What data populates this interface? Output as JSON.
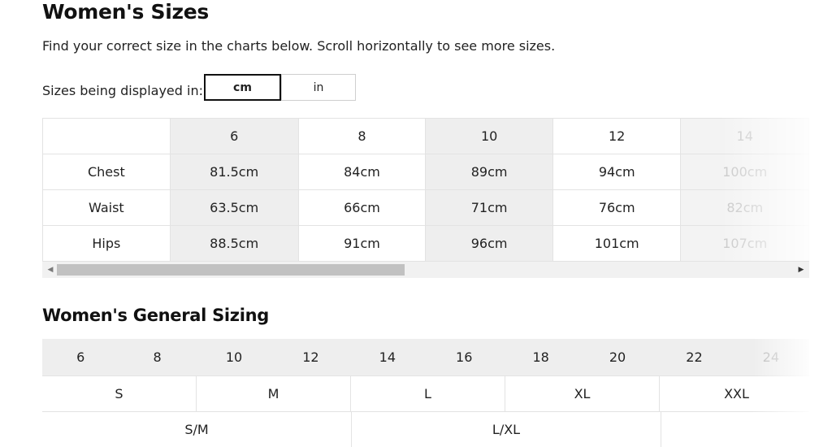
{
  "page": {
    "title": "Women's Sizes",
    "intro": "Find your correct size in the charts below. Scroll horizontally to see more sizes."
  },
  "units": {
    "label": "Sizes being displayed in:",
    "options": [
      "cm",
      "in"
    ],
    "selected": "cm"
  },
  "size_table": {
    "sizes": [
      "6",
      "8",
      "10",
      "12",
      "14"
    ],
    "rows": [
      {
        "label": "Chest",
        "values": [
          "81.5cm",
          "84cm",
          "89cm",
          "94cm",
          "100cm"
        ]
      },
      {
        "label": "Waist",
        "values": [
          "63.5cm",
          "66cm",
          "71cm",
          "76cm",
          "82cm"
        ]
      },
      {
        "label": "Hips",
        "values": [
          "88.5cm",
          "91cm",
          "96cm",
          "101cm",
          "107cm"
        ]
      }
    ]
  },
  "general": {
    "title": "Women's General Sizing",
    "sizes": [
      "6",
      "8",
      "10",
      "12",
      "14",
      "16",
      "18",
      "20",
      "22",
      "24"
    ],
    "letters": [
      "S",
      "M",
      "L",
      "XL",
      "XXL"
    ],
    "combos": [
      "S/M",
      "L/XL",
      ""
    ]
  },
  "icons": {
    "scroll_left": "triangle-left",
    "scroll_right": "triangle-right"
  }
}
